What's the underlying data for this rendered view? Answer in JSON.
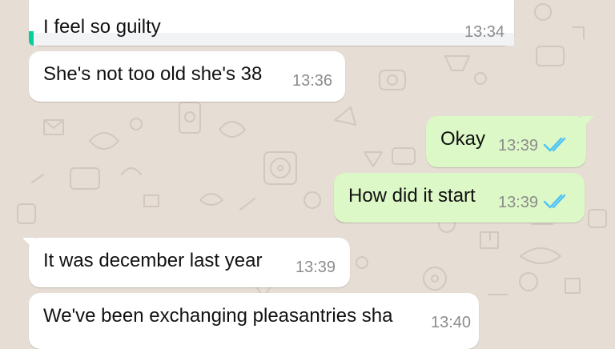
{
  "theme": {
    "incoming_bubble_color": "#ffffff",
    "outgoing_bubble_color": "#dcf8c6",
    "read_tick_color": "#4fc3f7",
    "wallpaper_color": "#e6ddd4"
  },
  "chat": {
    "messages": [
      {
        "direction": "incoming",
        "text": "I feel so guilty",
        "time": "13:34",
        "has_quote": true
      },
      {
        "direction": "incoming",
        "text": "She's not too old she's 38",
        "time": "13:36"
      },
      {
        "direction": "outgoing",
        "text": "Okay",
        "time": "13:39",
        "status": "read"
      },
      {
        "direction": "outgoing",
        "text": "How did it start",
        "time": "13:39",
        "status": "read"
      },
      {
        "direction": "incoming",
        "text": "It was december last year",
        "time": "13:39"
      },
      {
        "direction": "incoming",
        "text": "We've been exchanging pleasantries sha",
        "time": "13:40"
      }
    ]
  }
}
